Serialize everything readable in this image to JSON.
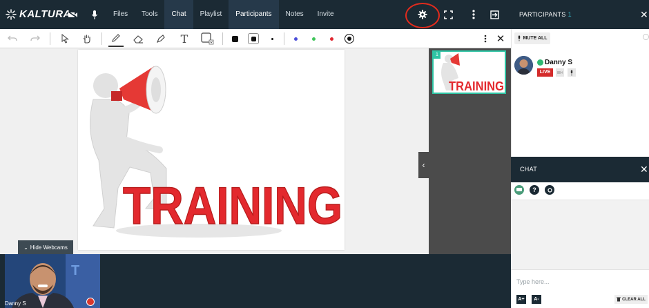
{
  "app": {
    "logo_text": "KALTURA"
  },
  "menu": [
    {
      "label": "Files"
    },
    {
      "label": "Tools"
    },
    {
      "label": "Chat"
    },
    {
      "label": "Playlist"
    },
    {
      "label": "Participants"
    },
    {
      "label": "Notes"
    },
    {
      "label": "Invite"
    }
  ],
  "participants_panel": {
    "title": "PARTICIPANTS",
    "count": "1",
    "mute_all": "MUTE ALL"
  },
  "participant": {
    "name": "Danny S",
    "status": "LIVE"
  },
  "slide": {
    "headline": "TRAINING"
  },
  "thumbnail": {
    "page": "1",
    "headline": "TRAINING"
  },
  "webcams": {
    "hide_label": "Hide Webcams",
    "cam_name": "Danny S"
  },
  "chat": {
    "title": "CHAT",
    "placeholder": "Type here...",
    "clear_all": "CLEAR ALL",
    "font_up": "A+",
    "font_down": "A-"
  },
  "colors": {
    "topbar": "#1b2a34",
    "accent": "#2ec4a4",
    "live": "#d42b2b",
    "annotation": "#e02b1d"
  },
  "icons": [
    "undo-icon",
    "redo-icon",
    "pointer-icon",
    "pan-icon",
    "pencil-icon",
    "eraser-icon",
    "highlighter-icon",
    "text-icon",
    "shape-icon",
    "settings-gear-icon",
    "fullscreen-icon",
    "more-icon",
    "exit-icon"
  ]
}
